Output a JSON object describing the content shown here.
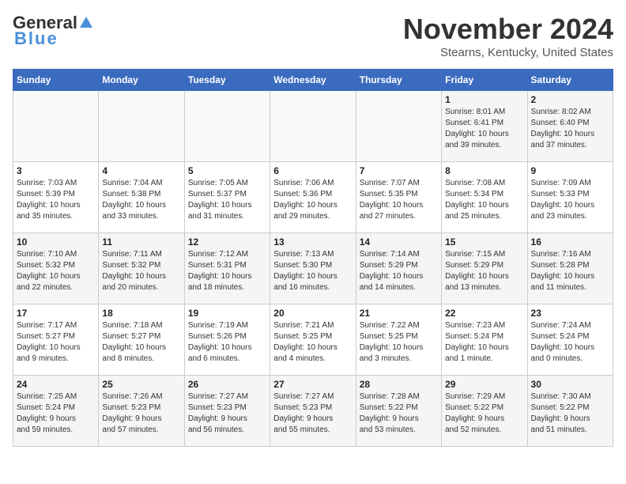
{
  "header": {
    "logo": {
      "general": "General",
      "blue": "Blue",
      "tagline": "Blue"
    },
    "title": "November 2024",
    "location": "Stearns, Kentucky, United States"
  },
  "weekdays": [
    "Sunday",
    "Monday",
    "Tuesday",
    "Wednesday",
    "Thursday",
    "Friday",
    "Saturday"
  ],
  "weeks": [
    {
      "days": [
        {
          "num": "",
          "detail": ""
        },
        {
          "num": "",
          "detail": ""
        },
        {
          "num": "",
          "detail": ""
        },
        {
          "num": "",
          "detail": ""
        },
        {
          "num": "",
          "detail": ""
        },
        {
          "num": "1",
          "detail": "Sunrise: 8:01 AM\nSunset: 6:41 PM\nDaylight: 10 hours\nand 39 minutes."
        },
        {
          "num": "2",
          "detail": "Sunrise: 8:02 AM\nSunset: 6:40 PM\nDaylight: 10 hours\nand 37 minutes."
        }
      ]
    },
    {
      "days": [
        {
          "num": "3",
          "detail": "Sunrise: 7:03 AM\nSunset: 5:39 PM\nDaylight: 10 hours\nand 35 minutes."
        },
        {
          "num": "4",
          "detail": "Sunrise: 7:04 AM\nSunset: 5:38 PM\nDaylight: 10 hours\nand 33 minutes."
        },
        {
          "num": "5",
          "detail": "Sunrise: 7:05 AM\nSunset: 5:37 PM\nDaylight: 10 hours\nand 31 minutes."
        },
        {
          "num": "6",
          "detail": "Sunrise: 7:06 AM\nSunset: 5:36 PM\nDaylight: 10 hours\nand 29 minutes."
        },
        {
          "num": "7",
          "detail": "Sunrise: 7:07 AM\nSunset: 5:35 PM\nDaylight: 10 hours\nand 27 minutes."
        },
        {
          "num": "8",
          "detail": "Sunrise: 7:08 AM\nSunset: 5:34 PM\nDaylight: 10 hours\nand 25 minutes."
        },
        {
          "num": "9",
          "detail": "Sunrise: 7:09 AM\nSunset: 5:33 PM\nDaylight: 10 hours\nand 23 minutes."
        }
      ]
    },
    {
      "days": [
        {
          "num": "10",
          "detail": "Sunrise: 7:10 AM\nSunset: 5:32 PM\nDaylight: 10 hours\nand 22 minutes."
        },
        {
          "num": "11",
          "detail": "Sunrise: 7:11 AM\nSunset: 5:32 PM\nDaylight: 10 hours\nand 20 minutes."
        },
        {
          "num": "12",
          "detail": "Sunrise: 7:12 AM\nSunset: 5:31 PM\nDaylight: 10 hours\nand 18 minutes."
        },
        {
          "num": "13",
          "detail": "Sunrise: 7:13 AM\nSunset: 5:30 PM\nDaylight: 10 hours\nand 16 minutes."
        },
        {
          "num": "14",
          "detail": "Sunrise: 7:14 AM\nSunset: 5:29 PM\nDaylight: 10 hours\nand 14 minutes."
        },
        {
          "num": "15",
          "detail": "Sunrise: 7:15 AM\nSunset: 5:29 PM\nDaylight: 10 hours\nand 13 minutes."
        },
        {
          "num": "16",
          "detail": "Sunrise: 7:16 AM\nSunset: 5:28 PM\nDaylight: 10 hours\nand 11 minutes."
        }
      ]
    },
    {
      "days": [
        {
          "num": "17",
          "detail": "Sunrise: 7:17 AM\nSunset: 5:27 PM\nDaylight: 10 hours\nand 9 minutes."
        },
        {
          "num": "18",
          "detail": "Sunrise: 7:18 AM\nSunset: 5:27 PM\nDaylight: 10 hours\nand 8 minutes."
        },
        {
          "num": "19",
          "detail": "Sunrise: 7:19 AM\nSunset: 5:26 PM\nDaylight: 10 hours\nand 6 minutes."
        },
        {
          "num": "20",
          "detail": "Sunrise: 7:21 AM\nSunset: 5:25 PM\nDaylight: 10 hours\nand 4 minutes."
        },
        {
          "num": "21",
          "detail": "Sunrise: 7:22 AM\nSunset: 5:25 PM\nDaylight: 10 hours\nand 3 minutes."
        },
        {
          "num": "22",
          "detail": "Sunrise: 7:23 AM\nSunset: 5:24 PM\nDaylight: 10 hours\nand 1 minute."
        },
        {
          "num": "23",
          "detail": "Sunrise: 7:24 AM\nSunset: 5:24 PM\nDaylight: 10 hours\nand 0 minutes."
        }
      ]
    },
    {
      "days": [
        {
          "num": "24",
          "detail": "Sunrise: 7:25 AM\nSunset: 5:24 PM\nDaylight: 9 hours\nand 59 minutes."
        },
        {
          "num": "25",
          "detail": "Sunrise: 7:26 AM\nSunset: 5:23 PM\nDaylight: 9 hours\nand 57 minutes."
        },
        {
          "num": "26",
          "detail": "Sunrise: 7:27 AM\nSunset: 5:23 PM\nDaylight: 9 hours\nand 56 minutes."
        },
        {
          "num": "27",
          "detail": "Sunrise: 7:27 AM\nSunset: 5:23 PM\nDaylight: 9 hours\nand 55 minutes."
        },
        {
          "num": "28",
          "detail": "Sunrise: 7:28 AM\nSunset: 5:22 PM\nDaylight: 9 hours\nand 53 minutes."
        },
        {
          "num": "29",
          "detail": "Sunrise: 7:29 AM\nSunset: 5:22 PM\nDaylight: 9 hours\nand 52 minutes."
        },
        {
          "num": "30",
          "detail": "Sunrise: 7:30 AM\nSunset: 5:22 PM\nDaylight: 9 hours\nand 51 minutes."
        }
      ]
    }
  ]
}
